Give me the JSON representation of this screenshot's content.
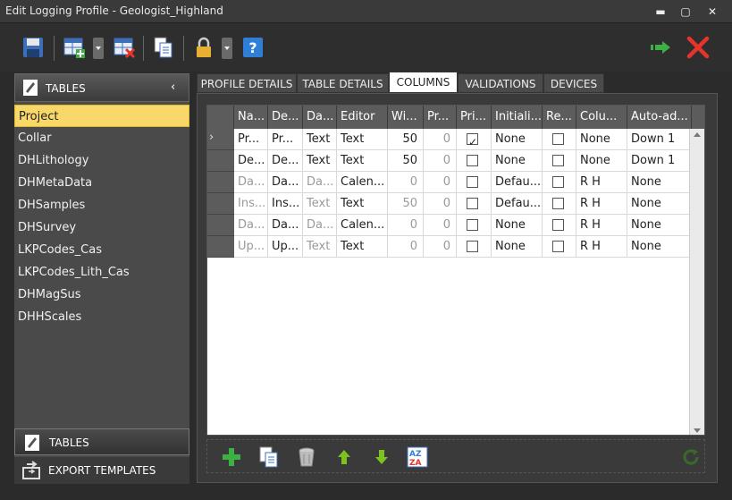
{
  "window": {
    "title": "Edit Logging Profile - Geologist_Highland",
    "minimize": "▬",
    "maximize": "▢",
    "close": "✕"
  },
  "left_panel": {
    "header": "TABLES",
    "items": [
      {
        "label": "Project",
        "selected": true
      },
      {
        "label": "Collar"
      },
      {
        "label": "DHLithology"
      },
      {
        "label": "DHMetaData"
      },
      {
        "label": "DHSamples"
      },
      {
        "label": "DHSurvey"
      },
      {
        "label": "LKPCodes_Cas"
      },
      {
        "label": "LKPCodes_Lith_Cas"
      },
      {
        "label": "DHMagSus"
      },
      {
        "label": "DHHScales"
      }
    ],
    "footer_tables": "TABLES",
    "footer_export": "EXPORT TEMPLATES"
  },
  "tabs": [
    {
      "label": "PROFILE DETAILS"
    },
    {
      "label": "TABLE DETAILS"
    },
    {
      "label": "COLUMNS",
      "active": true
    },
    {
      "label": "VALIDATIONS"
    },
    {
      "label": "DEVICES"
    }
  ],
  "grid": {
    "columns": [
      "Na...",
      "De...",
      "Da...",
      "Editor",
      "Wi...",
      "Pr...",
      "Pri...",
      "Initiali...",
      "Re...",
      "Colu...",
      "Auto-ad..."
    ],
    "rows": [
      {
        "name": "Pr...",
        "desc": "Pr...",
        "dtype": "Text",
        "editor": "Text",
        "width": "50",
        "prec": "0",
        "pri": true,
        "init": "None",
        "req": false,
        "col": "None",
        "auto": "Down 1",
        "dim": false,
        "current": true
      },
      {
        "name": "De...",
        "desc": "De...",
        "dtype": "Text",
        "editor": "Text",
        "width": "50",
        "prec": "0",
        "pri": false,
        "init": "None",
        "req": false,
        "col": "None",
        "auto": "Down 1",
        "dim": false
      },
      {
        "name": "Da...",
        "desc": "Da...",
        "dtype": "Da...",
        "editor": "Calen...",
        "width": "0",
        "prec": "0",
        "pri": false,
        "init": "Defau...",
        "req": false,
        "col": "R H",
        "auto": "None",
        "dim": true
      },
      {
        "name": "Ins...",
        "desc": "Ins...",
        "dtype": "Text",
        "editor": "Text",
        "width": "50",
        "prec": "0",
        "pri": false,
        "init": "Defau...",
        "req": false,
        "col": "R H",
        "auto": "None",
        "dim": true
      },
      {
        "name": "Da...",
        "desc": "Da...",
        "dtype": "Da...",
        "editor": "Calen...",
        "width": "0",
        "prec": "0",
        "pri": false,
        "init": "None",
        "req": false,
        "col": "R H",
        "auto": "None",
        "dim": true
      },
      {
        "name": "Up...",
        "desc": "Up...",
        "dtype": "Text",
        "editor": "Text",
        "width": "0",
        "prec": "0",
        "pri": false,
        "init": "None",
        "req": false,
        "col": "R H",
        "auto": "None",
        "dim": true
      }
    ]
  },
  "icons": {
    "accent_green": "#3cb043",
    "close_red": "#e8332a",
    "lock_gold": "#e8b030",
    "help_blue": "#2f7fd8"
  }
}
